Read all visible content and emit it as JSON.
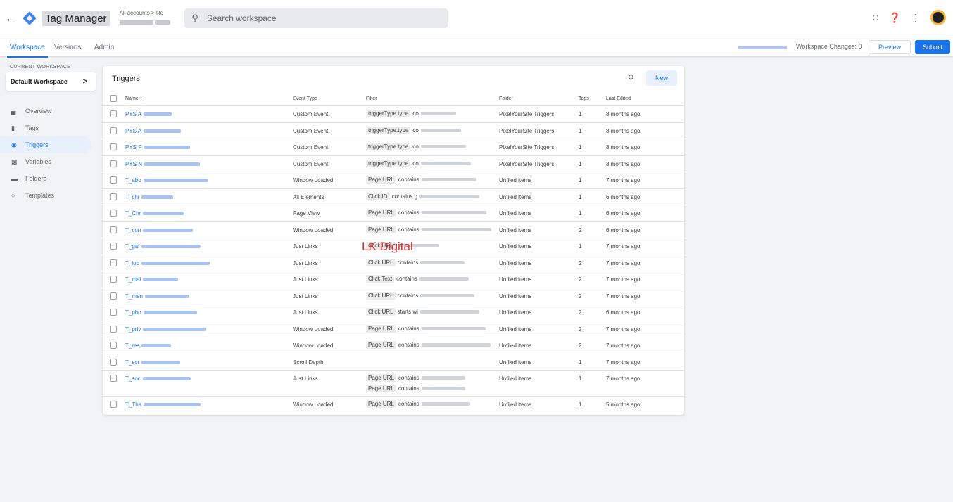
{
  "header": {
    "back_glyph": "←",
    "app_name": "Tag Manager",
    "account_line1": "All accounts > Re",
    "search_placeholder": "Search workspace"
  },
  "subnav": {
    "tabs": [
      "Workspace",
      "Versions",
      "Admin"
    ],
    "workspace_changes": "Workspace Changes: 0",
    "preview_label": "Preview",
    "submit_label": "Submit"
  },
  "sidebar": {
    "current_workspace_label": "CURRENT WORKSPACE",
    "workspace_name": "Default Workspace",
    "chevron": ">",
    "items": [
      {
        "label": "Overview",
        "icon": "folder-icon"
      },
      {
        "label": "Tags",
        "icon": "tag-icon"
      },
      {
        "label": "Triggers",
        "icon": "trigger-icon"
      },
      {
        "label": "Variables",
        "icon": "variables-icon"
      },
      {
        "label": "Folders",
        "icon": "folder-icon"
      },
      {
        "label": "Templates",
        "icon": "template-icon"
      }
    ]
  },
  "panel": {
    "title": "Triggers",
    "new_label": "New",
    "columns": [
      "Name ↑",
      "Event Type",
      "Filter",
      "Folder",
      "Tags",
      "Last Edited"
    ]
  },
  "rows": [
    {
      "name": "PYS A",
      "event": "Custom Event",
      "filter": [
        "triggerType.type",
        "co"
      ],
      "folder": "PixelYourSite Triggers",
      "tags": "1",
      "edited": "8 months ago"
    },
    {
      "name": "PYS A",
      "event": "Custom Event",
      "filter": [
        "triggerType.type",
        "co"
      ],
      "folder": "PixelYourSite Triggers",
      "tags": "1",
      "edited": "8 months ago"
    },
    {
      "name": "PYS F",
      "event": "Custom Event",
      "filter": [
        "triggerType.type",
        "co"
      ],
      "folder": "PixelYourSite Triggers",
      "tags": "1",
      "edited": "8 months ago"
    },
    {
      "name": "PYS N",
      "event": "Custom Event",
      "filter": [
        "triggerType.type",
        "co"
      ],
      "folder": "PixelYourSite Triggers",
      "tags": "1",
      "edited": "8 months ago"
    },
    {
      "name": "T_abo",
      "event": "Window Loaded",
      "filter": [
        "Page URL",
        "contains"
      ],
      "folder": "Unfiled items",
      "tags": "1",
      "edited": "7 months ago"
    },
    {
      "name": "T_chr",
      "event": "All Elements",
      "filter": [
        "Click ID",
        "contains g"
      ],
      "folder": "Unfiled items",
      "tags": "1",
      "edited": "6 months ago"
    },
    {
      "name": "T_Chr",
      "event": "Page View",
      "filter": [
        "Page URL",
        "contains"
      ],
      "folder": "Unfiled items",
      "tags": "1",
      "edited": "6 months ago"
    },
    {
      "name": "T_con",
      "event": "Window Loaded",
      "filter": [
        "Page URL",
        "contains"
      ],
      "folder": "Unfiled items",
      "tags": "2",
      "edited": "6 months ago"
    },
    {
      "name": "T_gal",
      "event": "Just Links",
      "filter": [
        "Click URL",
        ""
      ],
      "folder": "Unfiled items",
      "tags": "1",
      "edited": "7 months ago"
    },
    {
      "name": "T_loc",
      "event": "Just Links",
      "filter": [
        "Click URL",
        "contains"
      ],
      "folder": "Unfiled items",
      "tags": "2",
      "edited": "7 months ago"
    },
    {
      "name": "T_mai",
      "event": "Just Links",
      "filter": [
        "Click Text",
        "contains"
      ],
      "folder": "Unfiled items",
      "tags": "2",
      "edited": "7 months ago"
    },
    {
      "name": "T_men",
      "event": "Just Links",
      "filter": [
        "Click URL",
        "contains"
      ],
      "folder": "Unfiled items",
      "tags": "2",
      "edited": "7 months ago"
    },
    {
      "name": "T_pho",
      "event": "Just Links",
      "filter": [
        "Click URL",
        "starts wi"
      ],
      "folder": "Unfiled items",
      "tags": "2",
      "edited": "6 months ago"
    },
    {
      "name": "T_priv",
      "event": "Window Loaded",
      "filter": [
        "Page URL",
        "contains"
      ],
      "folder": "Unfiled items",
      "tags": "2",
      "edited": "7 months ago"
    },
    {
      "name": "T_res",
      "event": "Window Loaded",
      "filter": [
        "Page URL",
        "contains"
      ],
      "folder": "Unfiled items",
      "tags": "2",
      "edited": "7 months ago"
    },
    {
      "name": "T_scr",
      "event": "Scroll Depth",
      "filter": [],
      "folder": "Unfiled items",
      "tags": "1",
      "edited": "7 months ago"
    },
    {
      "name": "T_soc",
      "event": "Just Links",
      "filter": [
        "Page URL",
        "contains"
      ],
      "filter2": [
        "Page URL",
        "contains"
      ],
      "folder": "Unfiled items",
      "tags": "1",
      "edited": "7 months ago"
    },
    {
      "name": "T_Tha",
      "event": "Window Loaded",
      "filter": [
        "Page URL",
        "contains"
      ],
      "folder": "Unfiled items",
      "tags": "1",
      "edited": "5 months ago"
    }
  ],
  "watermark": "LK Digital"
}
